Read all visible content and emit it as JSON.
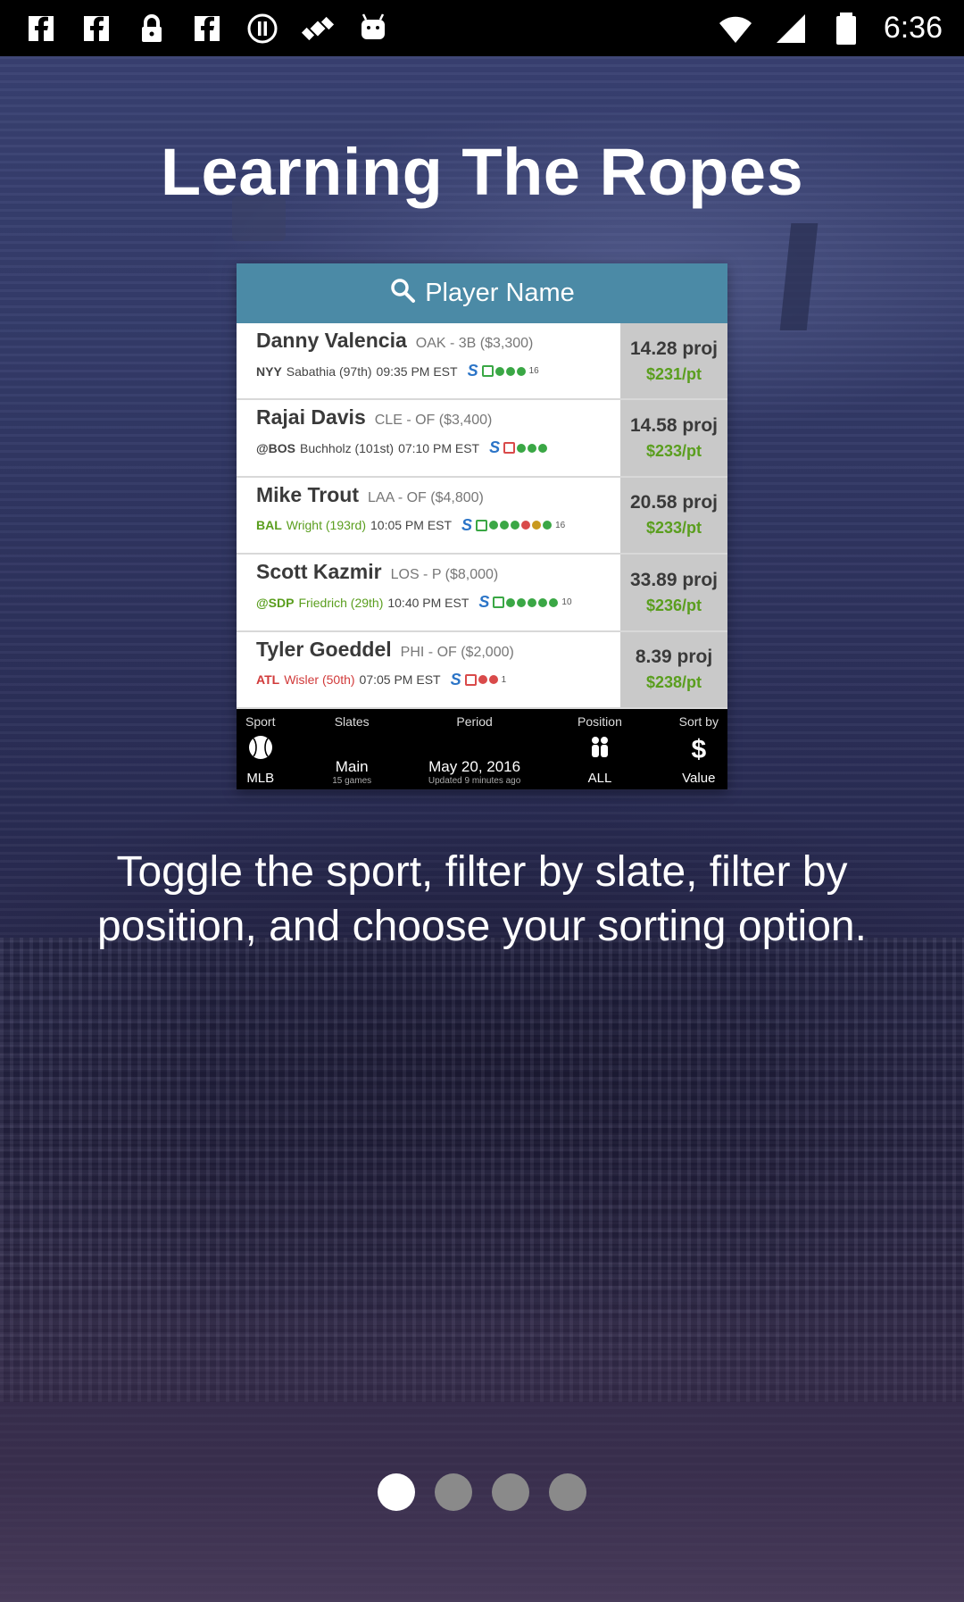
{
  "status_bar": {
    "time": "6:36",
    "icons": [
      "facebook-icon",
      "facebook-icon",
      "lock-icon",
      "facebook-icon",
      "stop-icon",
      "fake-gps-icon",
      "android-icon",
      "wifi-icon",
      "signal-icon",
      "battery-icon"
    ]
  },
  "onboarding": {
    "title": "Learning The Ropes",
    "description": "Toggle the sport, filter by slate, filter by position, and choose your sorting option."
  },
  "preview": {
    "search_placeholder": "Player Name",
    "players": [
      {
        "name": "Danny Valencia",
        "meta": "OAK - 3B ($3,300)",
        "opponent": "NYY",
        "pitcher": "Sabathia (97th)",
        "time": "09:35 PM EST",
        "proj": "14.28 proj",
        "per_pt": "$231/pt",
        "color": "default",
        "sup": "16"
      },
      {
        "name": "Rajai Davis",
        "meta": "CLE - OF ($3,400)",
        "opponent": "@BOS",
        "pitcher": "Buchholz (101st)",
        "time": "07:10 PM EST",
        "proj": "14.58 proj",
        "per_pt": "$233/pt",
        "color": "default",
        "sup": ""
      },
      {
        "name": "Mike Trout",
        "meta": "LAA - OF ($4,800)",
        "opponent": "BAL",
        "pitcher": "Wright (193rd)",
        "time": "10:05 PM EST",
        "proj": "20.58 proj",
        "per_pt": "$233/pt",
        "color": "green",
        "sup": "16"
      },
      {
        "name": "Scott Kazmir",
        "meta": "LOS - P ($8,000)",
        "opponent": "@SDP",
        "pitcher": "Friedrich (29th)",
        "time": "10:40 PM EST",
        "proj": "33.89 proj",
        "per_pt": "$236/pt",
        "color": "green",
        "sup": "10"
      },
      {
        "name": "Tyler Goeddel",
        "meta": "PHI - OF ($2,000)",
        "opponent": "ATL",
        "pitcher": "Wisler (50th)",
        "time": "07:05 PM EST",
        "proj": "8.39 proj",
        "per_pt": "$238/pt",
        "color": "red",
        "sup": "1"
      }
    ],
    "toolbar": {
      "sport_label": "Sport",
      "sport_value": "MLB",
      "slates_label": "Slates",
      "slates_value": "Main",
      "slates_sub": "15 games",
      "period_label": "Period",
      "period_value": "May 20, 2016",
      "period_sub": "Updated 9 minutes ago",
      "position_label": "Position",
      "position_value": "ALL",
      "sort_label": "Sort by",
      "sort_symbol": "$",
      "sort_value": "Value"
    }
  },
  "pager": {
    "total": 4,
    "active": 0
  }
}
